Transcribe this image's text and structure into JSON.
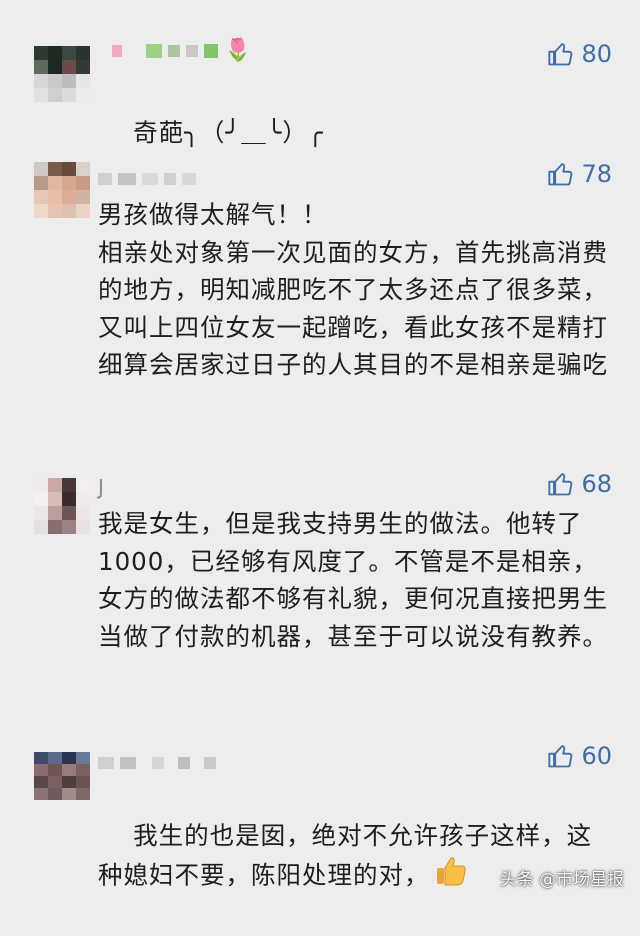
{
  "comments": [
    {
      "nickname": "",
      "likes": "80",
      "text": "奇葩╮（╯＿╰）╭",
      "has_flower_emoji": true
    },
    {
      "nickname": "",
      "likes": "78",
      "text": "男孩做得太解气！！\n相亲处对象第一次见面的女方，首先挑高消费的地方，明知减肥吃不了太多还点了很多菜，又叫上四位女友一起蹭吃，看此女孩不是精打细算会居家过日子的人其目的不是相亲是骗吃"
    },
    {
      "nickname": "J",
      "likes": "68",
      "text": "我是女生，但是我支持男生的做法。他转了1000，已经够有风度了。不管是不是相亲，女方的做法都不够有礼貌，更何况直接把男生当做了付款的机器，甚至于可以说没有教养。"
    },
    {
      "nickname": "",
      "likes": "60",
      "text": "我生的也是囡，绝对不允许孩子这样，这种媳妇不要，陈阳处理的对，",
      "has_thumb_emoji": true
    }
  ],
  "watermark": "头条 @市场星报",
  "colors": {
    "like_blue": "#3f6ea6",
    "background": "#ededed"
  }
}
